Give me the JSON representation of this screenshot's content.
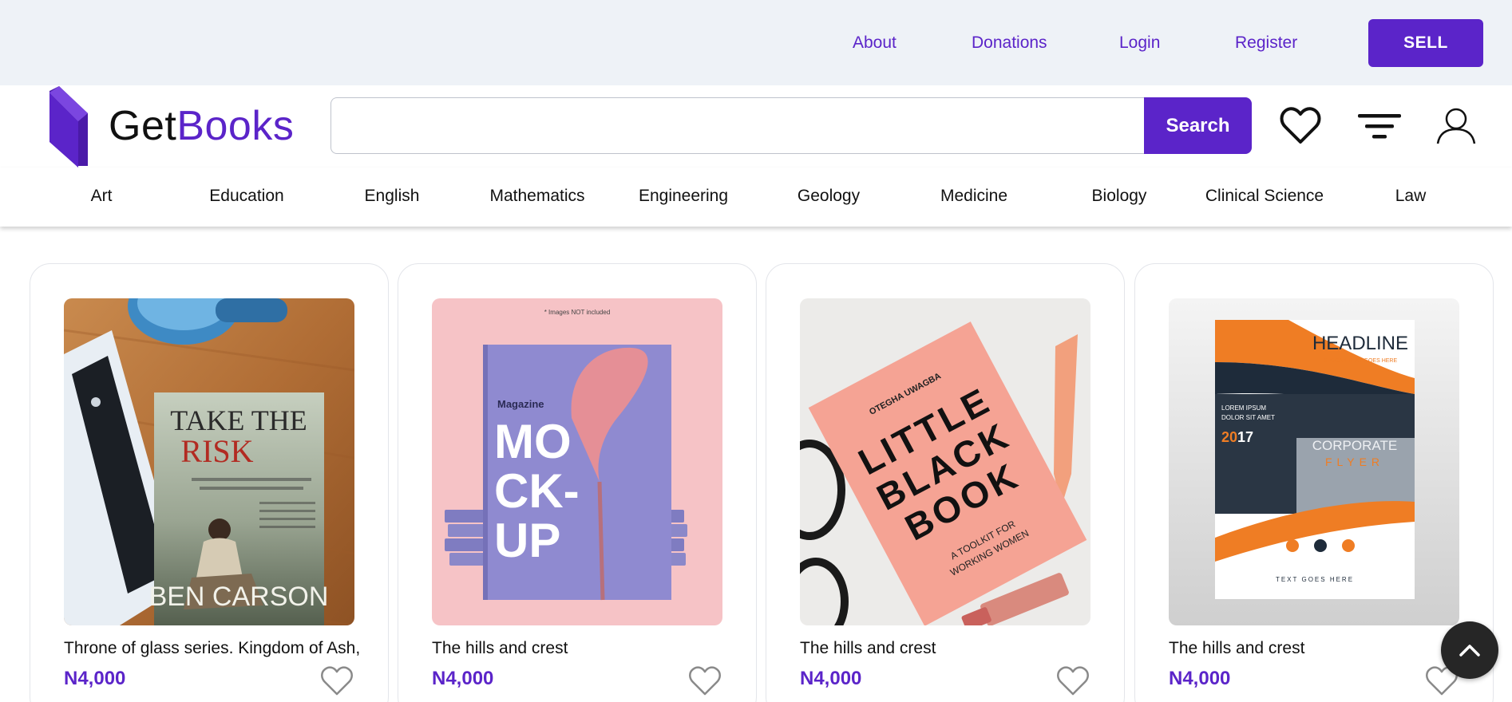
{
  "brand": {
    "name_part1": "Get",
    "name_part2": "Books",
    "accent_color": "#5b24c9"
  },
  "top_nav": {
    "links": [
      "About",
      "Donations",
      "Login",
      "Register"
    ],
    "sell_label": "SELL"
  },
  "search": {
    "value": "",
    "placeholder": "",
    "button_label": "Search"
  },
  "header_icons": [
    "heart-icon",
    "filter-icon",
    "user-icon"
  ],
  "categories": [
    "Art",
    "Education",
    "English",
    "Mathematics",
    "Engineering",
    "Geology",
    "Medicine",
    "Biology",
    "Clinical Science",
    "Law"
  ],
  "products": [
    {
      "title": "Throne of glass series. Kingdom of Ash, ...",
      "price": "N4,000",
      "cover": {
        "line1": "TAKE THE",
        "line2": "RISK",
        "author": "BEN CARSON"
      }
    },
    {
      "title": "The hills and crest",
      "price": "N4,000",
      "cover": {
        "note": "* Images NOT included",
        "kicker": "Magazine",
        "line1": "MO",
        "line2": "CK-",
        "line3": "UP"
      }
    },
    {
      "title": "The hills and crest",
      "price": "N4,000",
      "cover": {
        "author": "OTEGHA UWAGBA",
        "line1": "LITTLE",
        "line2": "BLACK",
        "line3": "BOOK",
        "subtitle1": "A TOOLKIT FOR",
        "subtitle2": "WORKING WOMEN"
      }
    },
    {
      "title": "The hills and crest",
      "price": "N4,000",
      "cover": {
        "headline": "HEADLINE",
        "slogan": "SLOGAN TEXT GOES HERE",
        "lorem1": "LOREM IPSUM",
        "lorem2": "DOLOR SIT AMET",
        "year_a": "20",
        "year_b": "17",
        "corporate": "CORPORATE",
        "flyer": "FLYER",
        "footer": "TEXT GOES HERE"
      }
    }
  ],
  "scroll_top_icon": "chevron-up-icon"
}
